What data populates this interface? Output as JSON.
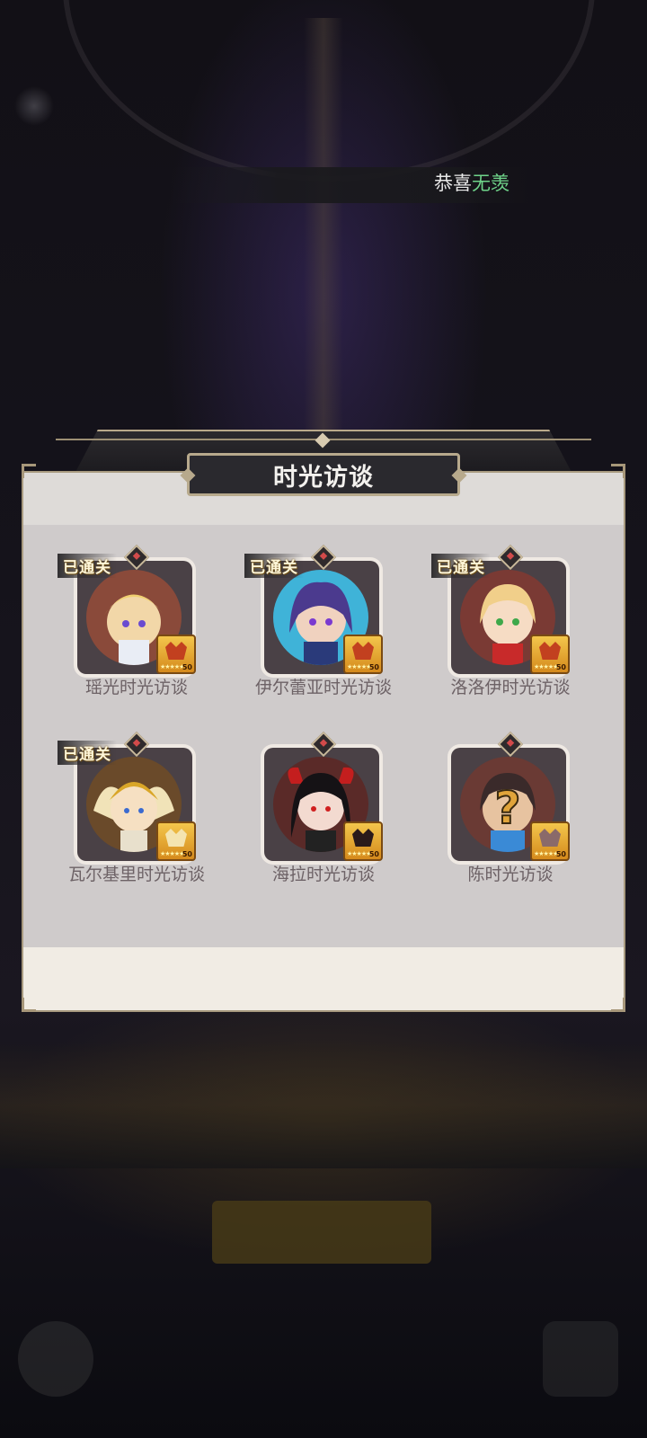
{
  "background": {
    "congrats_prefix": "恭喜",
    "congrats_name": "无羡"
  },
  "panel": {
    "title": "时光访谈",
    "cleared_label": "已通关",
    "cards": [
      {
        "name": "瑶光时光访谈",
        "cleared": true,
        "portrait": "yaoguang-portrait",
        "badge_level": "50",
        "badge_stars": "★★★★★"
      },
      {
        "name": "伊尔蕾亚时光访谈",
        "cleared": true,
        "portrait": "irelia-portrait",
        "badge_level": "50",
        "badge_stars": "★★★★★"
      },
      {
        "name": "洛洛伊时光访谈",
        "cleared": true,
        "portrait": "loloy-portrait",
        "badge_level": "50",
        "badge_stars": "★★★★★"
      },
      {
        "name": "瓦尔基里时光访谈",
        "cleared": true,
        "portrait": "valkyrie-portrait",
        "badge_level": "50",
        "badge_stars": "★★★★★"
      },
      {
        "name": "海拉时光访谈",
        "cleared": false,
        "portrait": "hela-portrait",
        "badge_level": "50",
        "badge_stars": "★★★★★"
      },
      {
        "name": "陈时光访谈",
        "cleared": false,
        "portrait": "chen-unknown-portrait",
        "badge_level": "50",
        "badge_stars": "★★★★★"
      }
    ]
  },
  "colors": {
    "panel_bg": "#dedbd8",
    "panel_inner": "#cfcbcb",
    "title_plate": "#2a292e",
    "accent_gold": "#b7a98c",
    "label_text": "#6d6266",
    "highlight_name": "#6fd48a"
  }
}
